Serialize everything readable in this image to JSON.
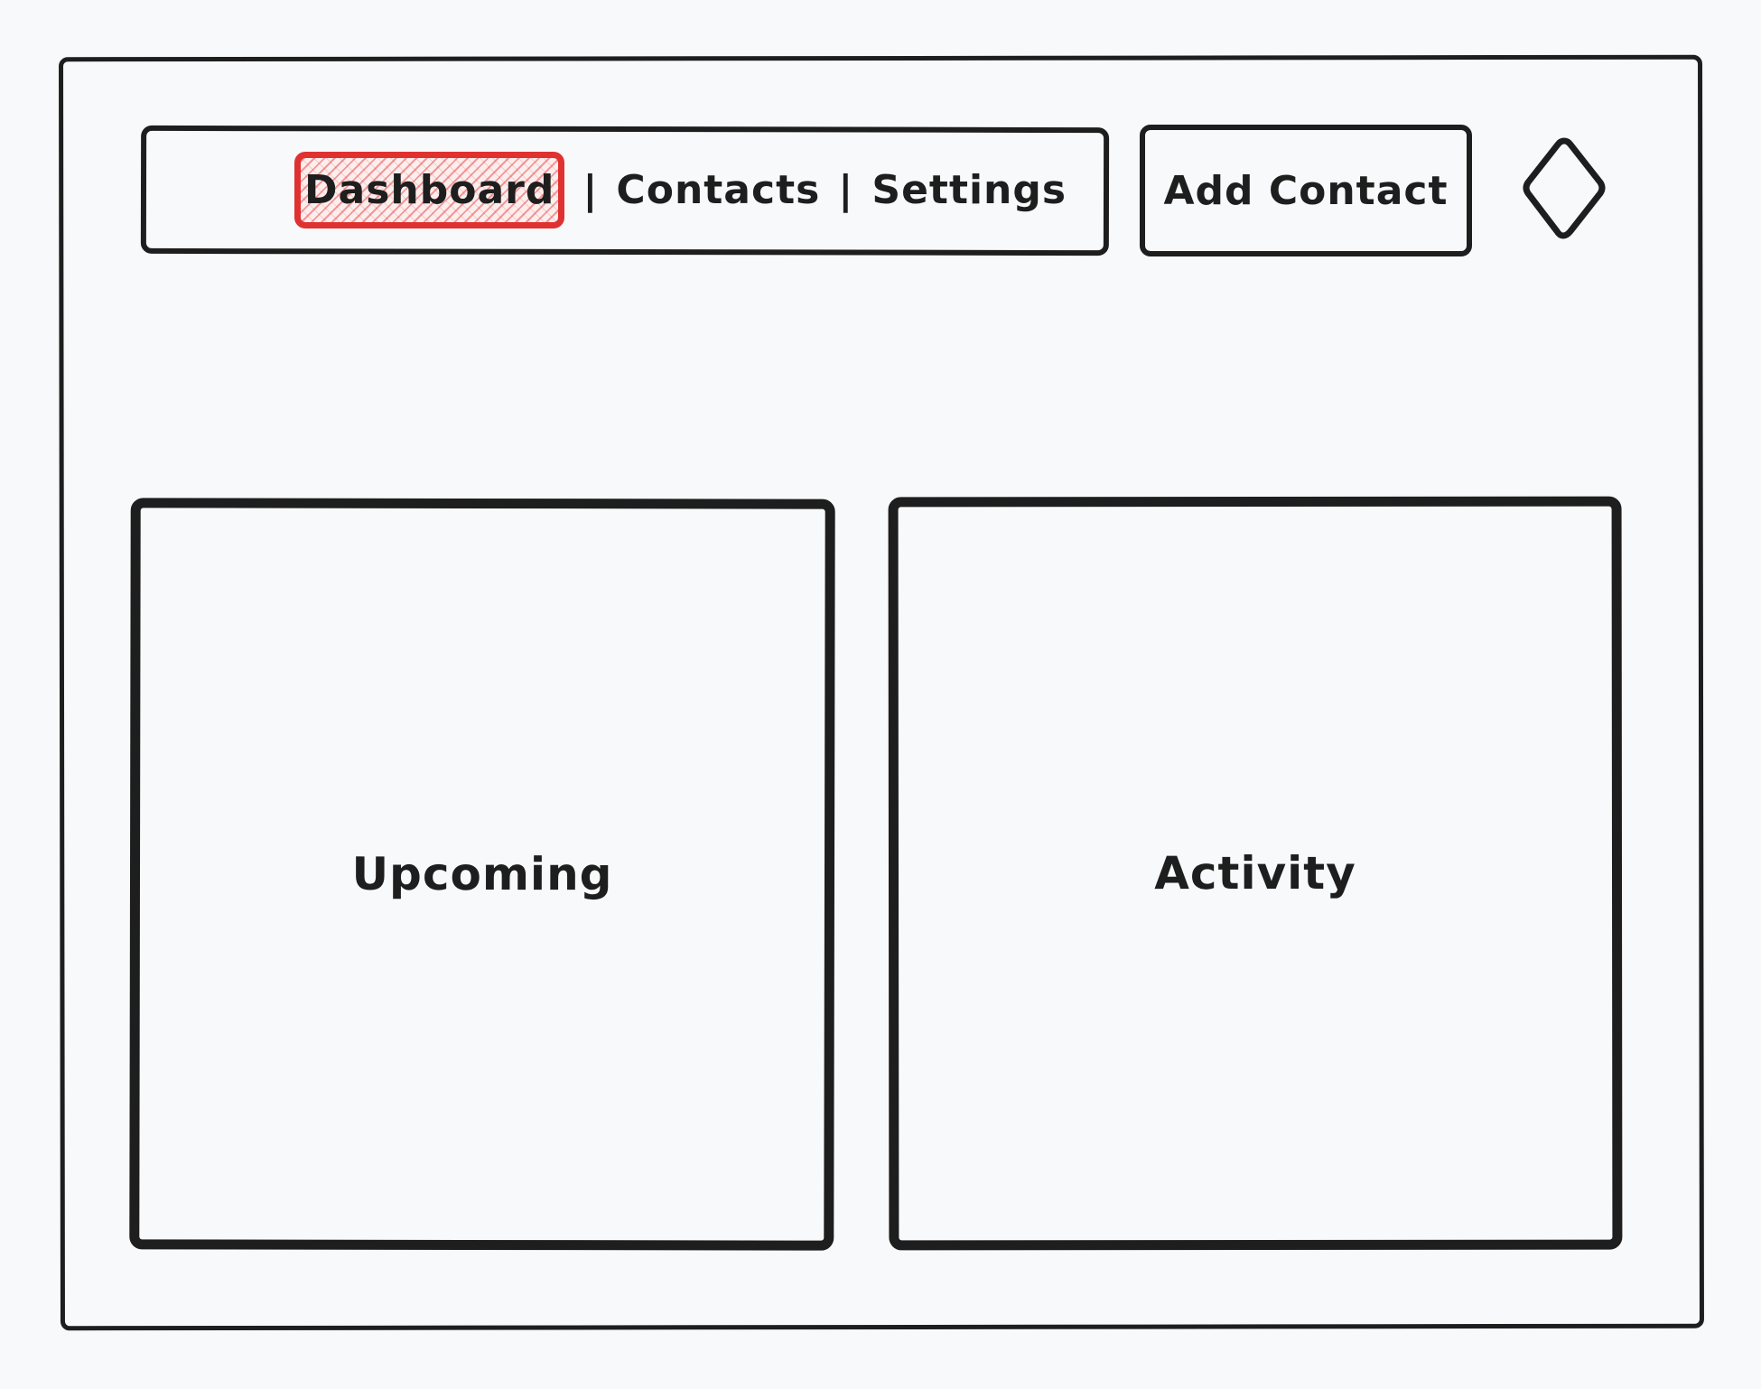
{
  "nav": {
    "items": [
      {
        "label": "Dashboard",
        "active": true
      },
      {
        "label": "Contacts",
        "active": false
      },
      {
        "label": "Settings",
        "active": false
      }
    ],
    "separator": "|"
  },
  "actions": {
    "add_contact_label": "Add Contact",
    "menu_icon": "diamond-icon"
  },
  "panels": {
    "upcoming_label": "Upcoming",
    "activity_label": "Activity"
  },
  "colors": {
    "ink": "#1e1e1e",
    "active_highlight": "#e03131",
    "background": "#f8f9fa"
  }
}
